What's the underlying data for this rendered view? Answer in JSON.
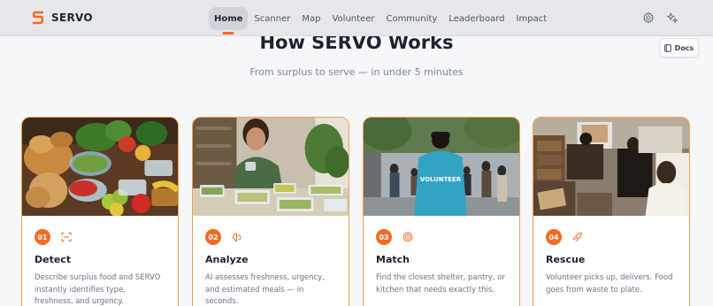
{
  "brand": {
    "name": "SERVO",
    "accent": "#f26b21"
  },
  "nav": {
    "links": [
      "Home",
      "Scanner",
      "Map",
      "Volunteer",
      "Community",
      "Leaderboard",
      "Impact"
    ],
    "active": "Home",
    "icons": [
      "gear-icon",
      "sparkle-icon"
    ]
  },
  "docs": {
    "label": "Docs",
    "icon": "book-icon"
  },
  "section": {
    "title": "How SERVO Works",
    "subtitle": "From surplus to serve — in under 5 minutes"
  },
  "steps": [
    {
      "number": "01",
      "icon": "scan-icon",
      "title": "Detect",
      "description": "Describe surplus food and SERVO instantly identifies type, freshness, and urgency."
    },
    {
      "number": "02",
      "icon": "brain-icon",
      "title": "Analyze",
      "description": "AI assesses freshness, urgency, and estimated meals — in seconds."
    },
    {
      "number": "03",
      "icon": "target-icon",
      "title": "Match",
      "description": "Find the closest shelter, pantry, or kitchen that needs exactly this."
    },
    {
      "number": "04",
      "icon": "rocket-icon",
      "title": "Rescue",
      "description": "Volunteer picks up, delivers. Food goes from waste to plate."
    }
  ],
  "card_images": [
    "food-spread-photo",
    "woman-packing-food-photo",
    "volunteer-crowd-photo",
    "warehouse-boxes-photo"
  ],
  "colors": {
    "card_border": "#f0a04b",
    "badge": "#f26b21",
    "navbar": "#e6e7ea"
  }
}
